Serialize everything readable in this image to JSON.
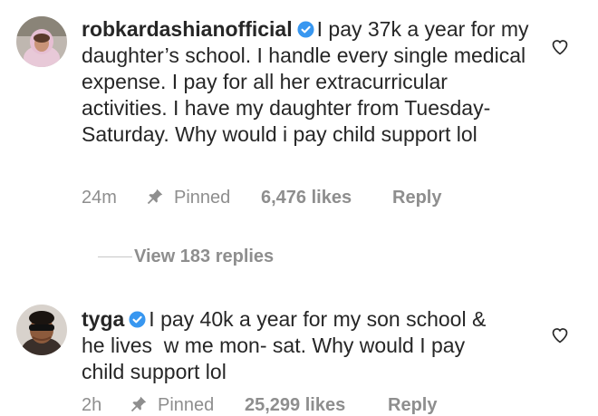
{
  "comments": [
    {
      "username": "robkardashianofficial",
      "verified": true,
      "text": "I pay 37k a year for my daughter’s school. I handle every single medical expense. I pay for all her extracurricular activities. I have my daughter from Tuesday-Saturday. Why would i pay child support lol",
      "time": "24m",
      "pinned_label": "Pinned",
      "likes": "6,476 likes",
      "reply_label": "Reply",
      "avatar_icon": "girl-in-pink-hoodie-avatar"
    },
    {
      "username": "tyga",
      "verified": true,
      "text": "I pay 40k a year for my son school & he lives  w me mon- sat. Why would I pay child support lol",
      "time": "2h",
      "pinned_label": "Pinned",
      "likes": "25,299 likes",
      "reply_label": "Reply",
      "avatar_icon": "man-in-sunglasses-avatar"
    }
  ],
  "view_replies": {
    "label": "View 183 replies"
  },
  "colors": {
    "text": "#262626",
    "secondary": "#8e8e8e",
    "verified_badge": "#3897f0",
    "divider": "#c7c7c7"
  },
  "icons": {
    "verified": "verified-badge-icon",
    "like": "heart-outline-icon",
    "pin": "pin-icon"
  }
}
